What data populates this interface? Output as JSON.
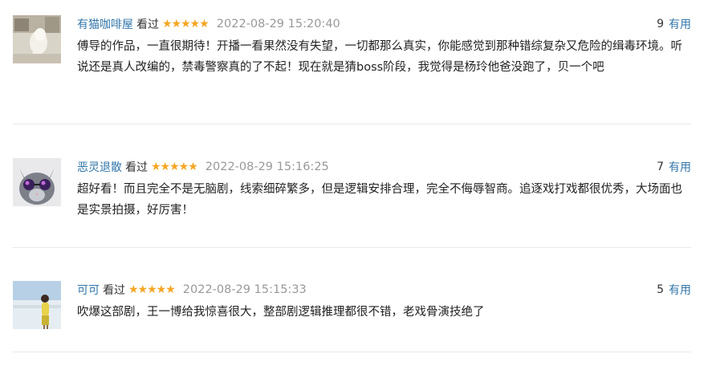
{
  "reviews": [
    {
      "username": "有猫咖啡屋",
      "status": "看过",
      "stars": "★★★★★",
      "time": "2022-08-29 15:20:40",
      "useful_count": "9",
      "useful_label": "有用",
      "content": "傅导的作品，一直很期待！开播一看果然没有失望，一切都那么真实，你能感觉到那种错综复杂又危险的缉毒环境。听说还是真人改编的，禁毒警察真的了不起！现在就是猜boss阶段，我觉得是杨玲他爸没跑了，贝一个吧",
      "avatar_icon": "cat-statue-avatar"
    },
    {
      "username": "恶灵退散",
      "status": "看过",
      "stars": "★★★★★",
      "time": "2022-08-29 15:16:25",
      "useful_count": "7",
      "useful_label": "有用",
      "content": "超好看！而且完全不是无脑剧，线索细碎繁多，但是逻辑安排合理，完全不侮辱智商。追逐戏打戏都很优秀，大场面也是实景拍摄，好厉害！",
      "avatar_icon": "cat-sunglasses-avatar"
    },
    {
      "username": "可可",
      "status": "看过",
      "stars": "★★★★★",
      "time": "2022-08-29 15:15:33",
      "useful_count": "5",
      "useful_label": "有用",
      "content": "吹爆这部剧，王一博给我惊喜很大，整部剧逻辑推理都很不错，老戏骨演技绝了",
      "avatar_icon": "person-beach-avatar"
    }
  ],
  "colors": {
    "link": "#3377aa",
    "star": "#f5a623",
    "time": "#999999",
    "divider": "#e8e8e8"
  }
}
